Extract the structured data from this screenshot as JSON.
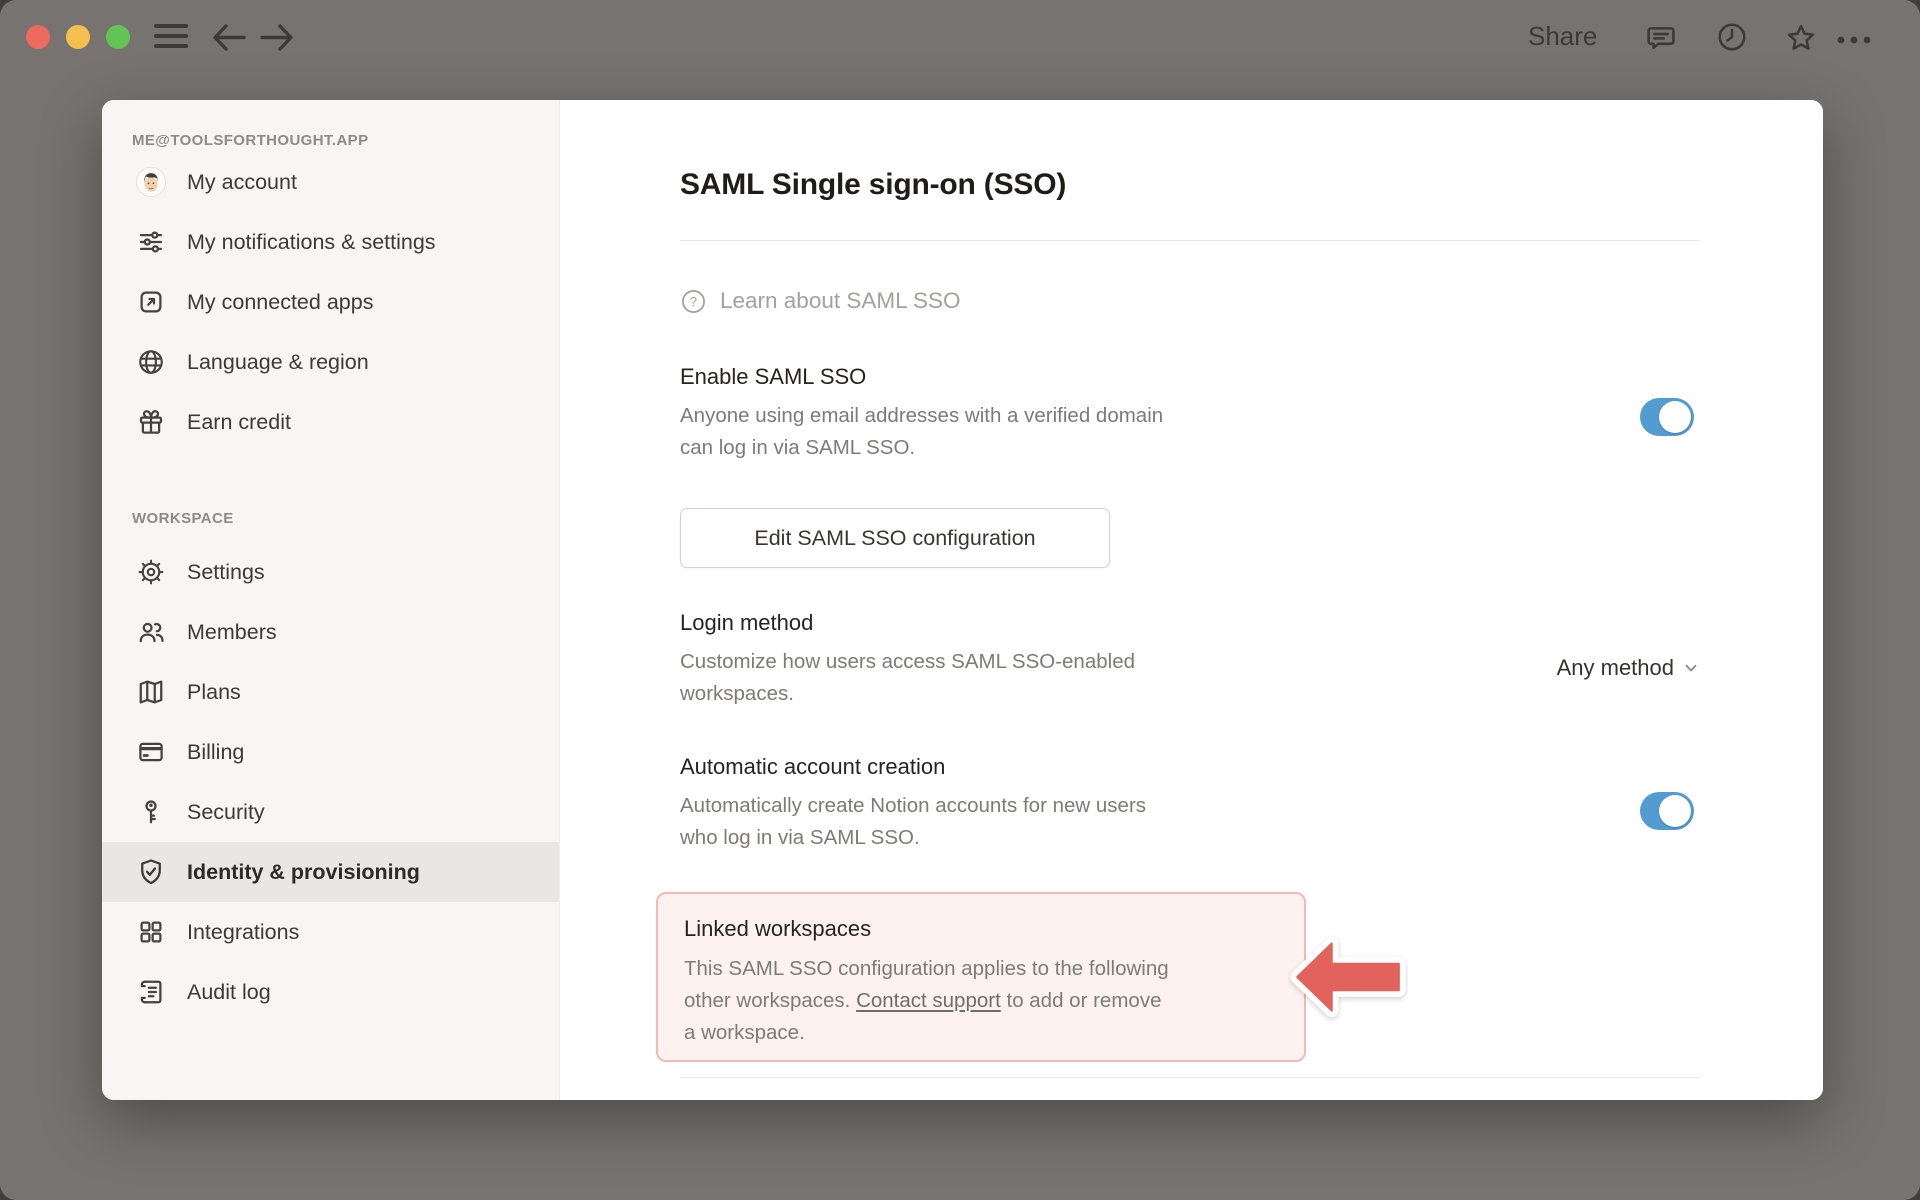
{
  "titlebar": {
    "share_label": "Share",
    "icons": [
      "hamburger",
      "back-arrow",
      "forward-arrow",
      "comment",
      "clock",
      "star",
      "more-ellipsis"
    ]
  },
  "sidebar": {
    "account_header": "ME@TOOLSFORTHOUGHT.APP",
    "account_items": [
      {
        "label": "My account",
        "icon": "avatar"
      },
      {
        "label": "My notifications & settings",
        "icon": "sliders"
      },
      {
        "label": "My connected apps",
        "icon": "arrow-up-right-box"
      },
      {
        "label": "Language & region",
        "icon": "globe"
      },
      {
        "label": "Earn credit",
        "icon": "gift"
      }
    ],
    "workspace_header": "WORKSPACE",
    "workspace_items": [
      {
        "label": "Settings",
        "icon": "gear",
        "selected": false
      },
      {
        "label": "Members",
        "icon": "people",
        "selected": false
      },
      {
        "label": "Plans",
        "icon": "map",
        "selected": false
      },
      {
        "label": "Billing",
        "icon": "credit-card",
        "selected": false
      },
      {
        "label": "Security",
        "icon": "key",
        "selected": false
      },
      {
        "label": "Identity & provisioning",
        "icon": "shield-check",
        "selected": true
      },
      {
        "label": "Integrations",
        "icon": "grid",
        "selected": false
      },
      {
        "label": "Audit log",
        "icon": "document-lines",
        "selected": false
      }
    ]
  },
  "main": {
    "title": "SAML Single sign-on (SSO)",
    "learn_link": "Learn about SAML SSO",
    "enable": {
      "heading": "Enable SAML SSO",
      "lines": [
        "Anyone using email addresses with a verified domain",
        "can log in via SAML SSO."
      ],
      "toggle_on": true
    },
    "edit_button": "Edit SAML SSO configuration",
    "login_method": {
      "heading": "Login method",
      "lines": [
        "Customize how users access SAML SSO-enabled",
        "workspaces."
      ],
      "value": "Any method"
    },
    "auto_account": {
      "heading": "Automatic account creation",
      "lines": [
        "Automatically create Notion accounts for new users",
        "who log in via SAML SSO."
      ],
      "toggle_on": true
    },
    "linked_workspaces": {
      "heading": "Linked workspaces",
      "line1": "This SAML SSO configuration applies to the following",
      "line2_before": "other workspaces. ",
      "link_text": "Contact support",
      "line2_after": " to add or remove",
      "line3": "a workspace."
    }
  },
  "colors": {
    "chrome-bg": "#767370",
    "sidebar-bg": "#f7f6f4",
    "selected-row-bg": "#e9e7e4",
    "accent-blue": "#539cd2",
    "arrow-red": "#e2635b",
    "highlight-pink-bg": "#fdf2f0",
    "highlight-pink-border": "#f1bab2",
    "traffic-red": "#ec6a5e",
    "traffic-yellow": "#f4bf4f",
    "traffic-green": "#61c455"
  }
}
